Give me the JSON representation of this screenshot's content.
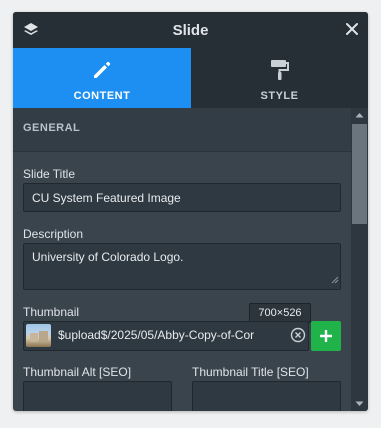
{
  "header": {
    "title": "Slide"
  },
  "tabs": [
    {
      "label": "CONTENT"
    },
    {
      "label": "STYLE"
    }
  ],
  "section": {
    "title": "GENERAL"
  },
  "slide_title": {
    "label": "Slide Title",
    "value": "CU System Featured Image"
  },
  "description": {
    "label": "Description",
    "value": "University of Colorado Logo."
  },
  "thumbnail": {
    "label": "Thumbnail",
    "dimensions": "700×526",
    "path": "$upload$/2025/05/Abby-Copy-of-Cor"
  },
  "thumbnail_alt": {
    "label": "Thumbnail Alt [SEO]"
  },
  "thumbnail_title": {
    "label": "Thumbnail Title [SEO]"
  },
  "colors": {
    "accent": "#1e8ff2",
    "add": "#1fb34a",
    "panel": "#3a444d",
    "header": "#262f36"
  }
}
